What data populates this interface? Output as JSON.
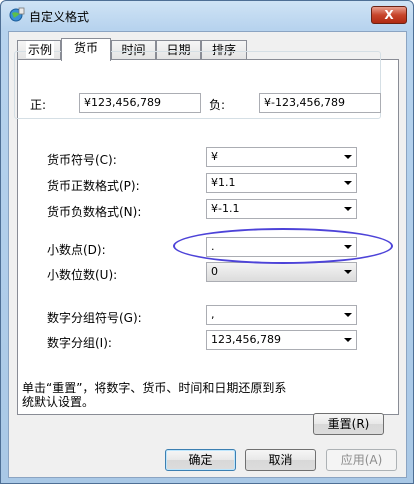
{
  "window": {
    "title": "自定义格式",
    "close_label": "X"
  },
  "tabs": [
    {
      "label": "数字"
    },
    {
      "label": "货币"
    },
    {
      "label": "时间"
    },
    {
      "label": "日期"
    },
    {
      "label": "排序"
    }
  ],
  "example": {
    "group_title": "示例",
    "positive_label": "正:",
    "positive_value": "¥123,456,789",
    "negative_label": "负:",
    "negative_value": "¥-123,456,789"
  },
  "settings": {
    "currency_symbol": {
      "label": "货币符号(C):",
      "value": "¥"
    },
    "positive_format": {
      "label": "货币正数格式(P):",
      "value": "¥1.1"
    },
    "negative_format": {
      "label": "货币负数格式(N):",
      "value": "¥-1.1"
    },
    "decimal_symbol": {
      "label": "小数点(D):",
      "value": "."
    },
    "decimal_digits": {
      "label": "小数位数(U):",
      "value": "0"
    },
    "grouping_symbol": {
      "label": "数字分组符号(G):",
      "value": ","
    },
    "digit_grouping": {
      "label": "数字分组(I):",
      "value": "123,456,789"
    }
  },
  "note": "单击“重置”，将数字、货币、时间和日期还原到系统默认设置。",
  "buttons": {
    "reset": "重置(R)",
    "ok": "确定",
    "cancel": "取消",
    "apply": "应用(A)"
  },
  "highlight_color": "#4d43d8"
}
